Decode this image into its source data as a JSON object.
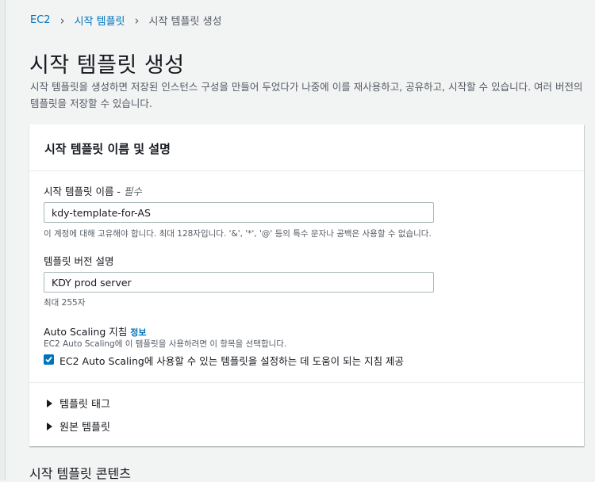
{
  "breadcrumb": {
    "items": [
      "EC2",
      "시작 템플릿"
    ],
    "current": "시작 템플릿 생성"
  },
  "page": {
    "title": "시작 템플릿 생성",
    "description": "시작 템플릿을 생성하면 저장된 인스턴스 구성을 만들어 두었다가 나중에 이를 재사용하고, 공유하고, 시작할 수 있습니다. 여러 버전의 템플릿을 저장할 수 있습니다."
  },
  "panel": {
    "title": "시작 템플릿 이름 및 설명",
    "name_field": {
      "label": "시작 템플릿 이름 - ",
      "required": "필수",
      "value": "kdy-template-for-AS",
      "hint": "이 계정에 대해 고유해야 합니다. 최대 128자입니다. '&', '*', '@' 등의 특수 문자나 공백은 사용할 수 없습니다."
    },
    "version_field": {
      "label": "템플릿 버전 설명",
      "value": "KDY prod server",
      "hint": "최대 255자"
    },
    "autoscaling": {
      "label": "Auto Scaling 지침",
      "info": "정보",
      "hint": "EC2 Auto Scaling에 이 템플릿을 사용하려면 이 항목을 선택합니다.",
      "checkbox_label": "EC2 Auto Scaling에 사용할 수 있는 템플릿을 설정하는 데 도움이 되는 지침 제공",
      "checked": true
    },
    "expanders": [
      "템플릿 태그",
      "원본 템플릿"
    ]
  },
  "next_section": {
    "title": "시작 템플릿 콘텐츠"
  },
  "colors": {
    "link": "#0073bb",
    "background": "#f2f3f3",
    "panel": "#ffffff"
  }
}
